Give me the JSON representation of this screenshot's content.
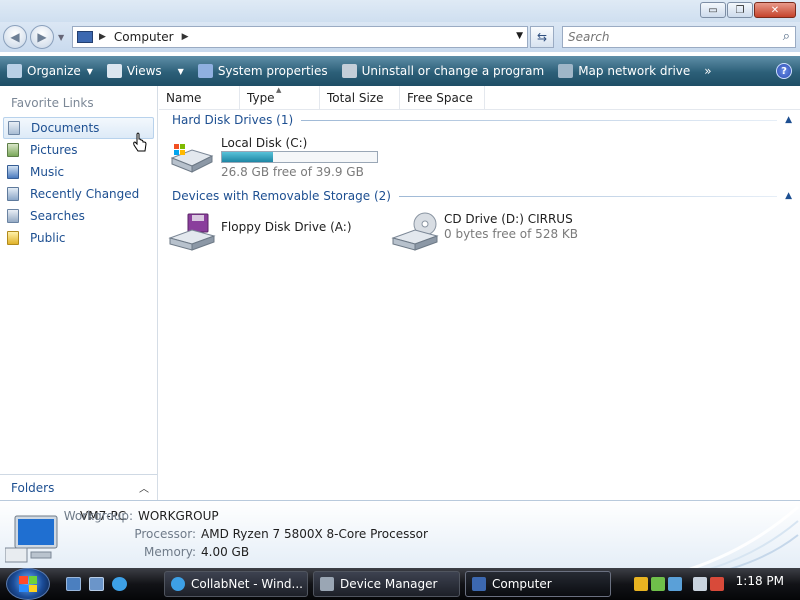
{
  "window": {
    "buttons": {
      "minimize": "▭",
      "maximize": "❐",
      "close": "✕"
    }
  },
  "address": {
    "crumbs": [
      "Computer"
    ],
    "search_placeholder": "Search"
  },
  "toolbar": {
    "items": [
      "Organize",
      "Views",
      "System properties",
      "Uninstall or change a program",
      "Map network drive"
    ],
    "more": "»",
    "help": "?"
  },
  "nav": {
    "favorite_title": "Favorite Links",
    "items": [
      "Documents",
      "Pictures",
      "Music",
      "Recently Changed",
      "Searches",
      "Public"
    ],
    "selected": "Documents",
    "folders": "Folders"
  },
  "columns": [
    "Name",
    "Type",
    "Total Size",
    "Free Space"
  ],
  "groups": {
    "hdd": {
      "label": "Hard Disk Drives (1)"
    },
    "removable": {
      "label": "Devices with Removable Storage (2)"
    }
  },
  "drives": {
    "local": {
      "name": "Local Disk (C:)",
      "free_text": "26.8 GB free of 39.9 GB",
      "used_fraction": 0.33
    },
    "floppy": {
      "name": "Floppy Disk Drive (A:)"
    },
    "cd": {
      "name": "CD Drive (D:) CIRRUS",
      "free_text": "0 bytes free of 528 KB"
    }
  },
  "details": {
    "name": "VM7-PC",
    "workgroup_label": "Workgroup:",
    "workgroup": "WORKGROUP",
    "processor_label": "Processor:",
    "processor": "AMD Ryzen 7 5800X 8-Core Processor",
    "memory_label": "Memory:",
    "memory": "4.00 GB"
  },
  "taskbar": {
    "tasks": [
      "CollabNet - Wind...",
      "Device Manager",
      "Computer"
    ],
    "active_task": "Computer",
    "clock": "1:18 PM"
  },
  "colors": {
    "toolbar": "#2c5f78",
    "link": "#1d4f91",
    "progress": "#1d86a4"
  }
}
